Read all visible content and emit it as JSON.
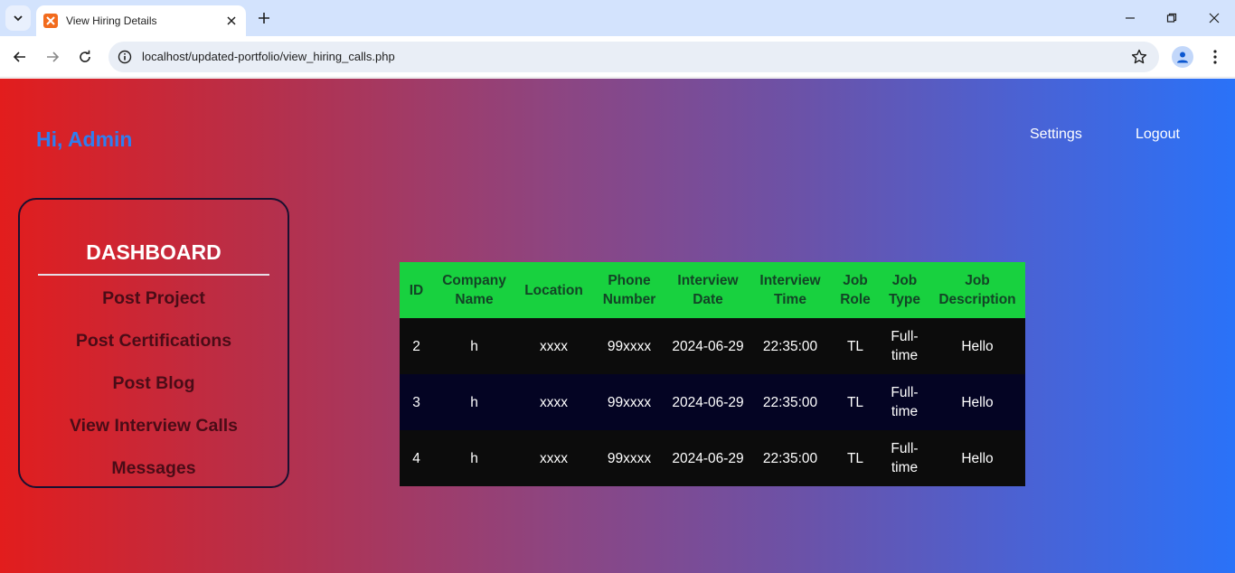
{
  "browser": {
    "tab_title": "View Hiring Details",
    "url": "localhost/updated-portfolio/view_hiring_calls.php",
    "favicon": "xampp-icon"
  },
  "header": {
    "greeting": "Hi, Admin",
    "nav": [
      "Settings",
      "Logout"
    ]
  },
  "sidebar": {
    "title": "DASHBOARD",
    "items": [
      "Post Project",
      "Post Certifications",
      "Post Blog",
      "View Interview Calls",
      "Messages"
    ]
  },
  "table": {
    "headers": [
      "ID",
      "Company Name",
      "Location",
      "Phone Number",
      "Interview Date",
      "Interview Time",
      "Job Role",
      "Job Type",
      "Job Description"
    ],
    "rows": [
      [
        "2",
        "h",
        "xxxx",
        "99xxxx",
        "2024-06-29",
        "22:35:00",
        "TL",
        "Full-time",
        "Hello"
      ],
      [
        "3",
        "h",
        "xxxx",
        "99xxxx",
        "2024-06-29",
        "22:35:00",
        "TL",
        "Full-time",
        "Hello"
      ],
      [
        "4",
        "h",
        "xxxx",
        "99xxxx",
        "2024-06-29",
        "22:35:00",
        "TL",
        "Full-time",
        "Hello"
      ]
    ]
  },
  "colors": {
    "gradient_left": "#e21d1d",
    "gradient_right": "#2a72f8",
    "greeting": "#2f7ef0",
    "table_header_bg": "#18d13f",
    "table_header_text": "#134426",
    "row_dark": "#0c0c0c",
    "row_navy": "#040423",
    "sidebar_item_text": "#4a0c17"
  }
}
